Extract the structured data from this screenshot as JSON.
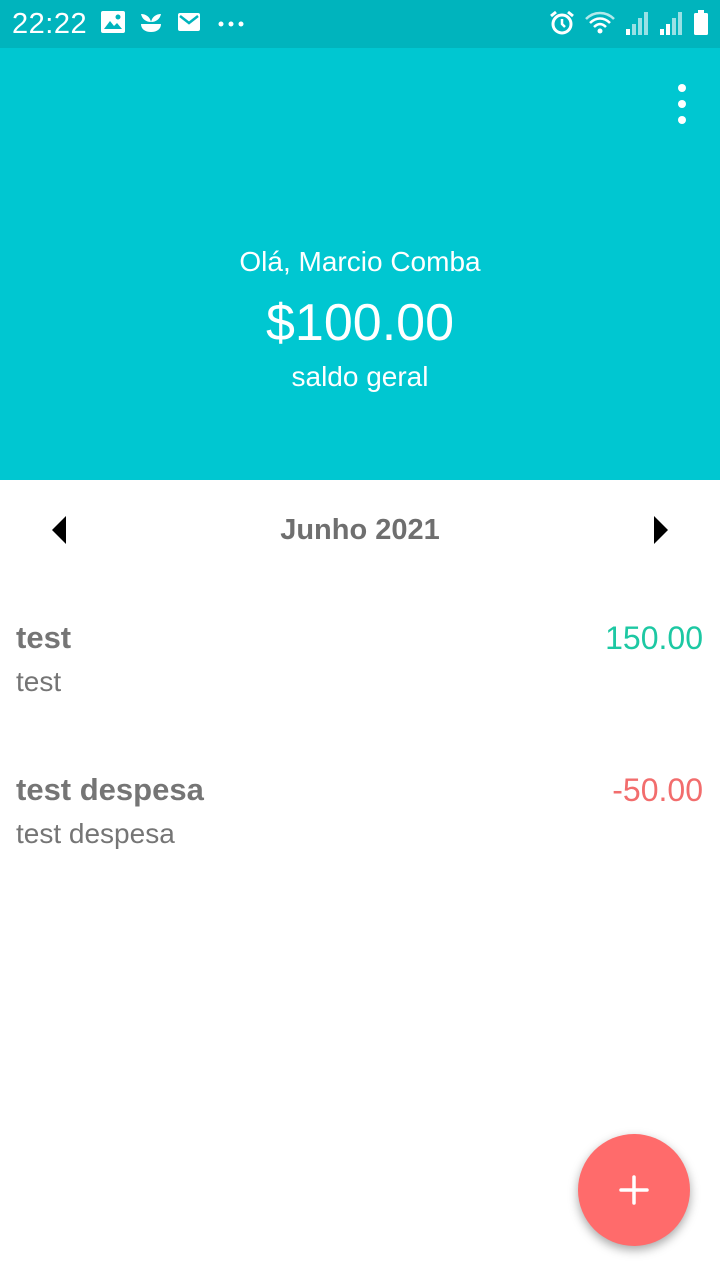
{
  "status_bar": {
    "time": "22:22",
    "left_icons": [
      "image-icon",
      "plant-icon",
      "mail-icon",
      "more-dots-icon"
    ],
    "right_icons": [
      "alarm-icon",
      "wifi-icon",
      "signal-icon",
      "signal-icon",
      "battery-icon"
    ]
  },
  "header": {
    "greeting": "Olá, Marcio Comba",
    "balance": "$100.00",
    "balance_label": "saldo geral",
    "background_color": "#00c7d1",
    "menu_icon": "more-vertical-icon"
  },
  "month_nav": {
    "label": "Junho 2021",
    "prev_icon": "arrow-left-icon",
    "next_icon": "arrow-right-icon"
  },
  "transactions": [
    {
      "title": "test",
      "description": "test",
      "amount": "150.00",
      "color": "#1dc8a3"
    },
    {
      "title": "test despesa",
      "description": "test despesa",
      "amount": "-50.00",
      "color": "#f26d6d"
    }
  ],
  "fab": {
    "icon": "plus-icon",
    "color": "#ff6b6b"
  }
}
